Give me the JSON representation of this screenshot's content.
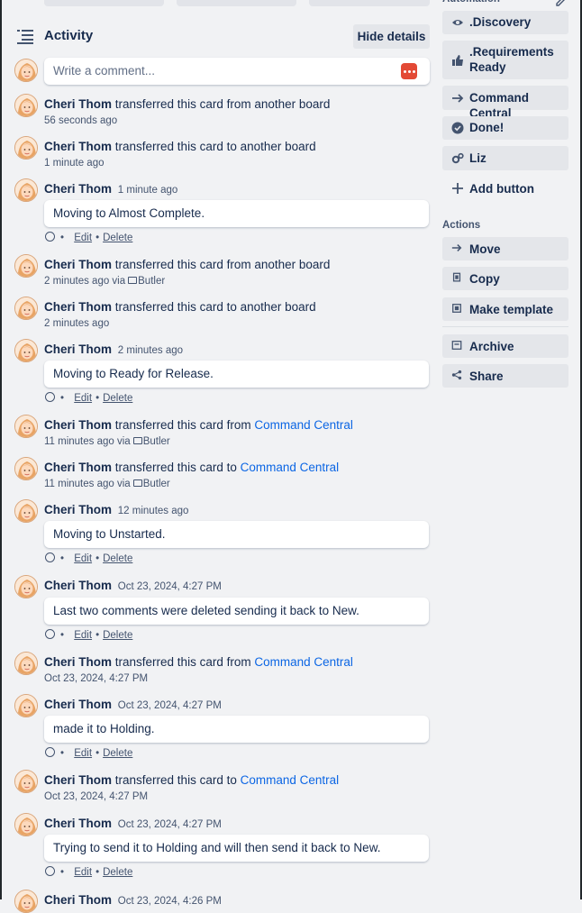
{
  "activity": {
    "title": "Activity",
    "hide_details_label": "Hide details",
    "comment_placeholder": "Write a comment..."
  },
  "entries": [
    {
      "user": "Cheri Thom",
      "action": "transferred this card from another board",
      "time": "56 seconds ago"
    },
    {
      "user": "Cheri Thom",
      "action": "transferred this card to another board",
      "time": "1 minute ago"
    },
    {
      "user": "Cheri Thom",
      "time": "1 minute ago",
      "comment": "Moving to Almost Complete."
    },
    {
      "user": "Cheri Thom",
      "action": "transferred this card from another board",
      "time": "2 minutes ago via",
      "via": "Butler"
    },
    {
      "user": "Cheri Thom",
      "action": "transferred this card to another board",
      "time": "2 minutes ago"
    },
    {
      "user": "Cheri Thom",
      "time": "2 minutes ago",
      "comment": "Moving to Ready for Release."
    },
    {
      "user": "Cheri Thom",
      "action": "transferred this card from",
      "link": "Command Central",
      "time": "11 minutes ago via",
      "via": "Butler"
    },
    {
      "user": "Cheri Thom",
      "action": "transferred this card to",
      "link": "Command Central",
      "time": "11 minutes ago via",
      "via": "Butler"
    },
    {
      "user": "Cheri Thom",
      "time": "12 minutes ago",
      "comment": "Moving to Unstarted."
    },
    {
      "user": "Cheri Thom",
      "time": "Oct 23, 2024, 4:27 PM",
      "comment": "Last two comments were deleted sending it back to New."
    },
    {
      "user": "Cheri Thom",
      "action": "transferred this card from",
      "link": "Command Central",
      "time": "Oct 23, 2024, 4:27 PM"
    },
    {
      "user": "Cheri Thom",
      "time": "Oct 23, 2024, 4:27 PM",
      "comment": "made it to Holding."
    },
    {
      "user": "Cheri Thom",
      "action": "transferred this card to",
      "link": "Command Central",
      "time": "Oct 23, 2024, 4:27 PM"
    },
    {
      "user": "Cheri Thom",
      "time": "Oct 23, 2024, 4:27 PM",
      "comment": "Trying to send it to Holding and will then send it back to New."
    },
    {
      "user": "Cheri Thom",
      "time": "Oct 23, 2024, 4:26 PM"
    }
  ],
  "comment_actions": {
    "edit": "Edit",
    "delete": "Delete",
    "bullet": "•"
  },
  "sidebar": {
    "automation_label": "Automation",
    "automation_buttons": [
      {
        "label": ".Discovery",
        "icon": "eye-icon"
      },
      {
        "label": ".Requirements Ready",
        "icon": "thumbs-up-icon"
      },
      {
        "label": "Command Central",
        "icon": "arrow-right-icon"
      },
      {
        "label": "Done!",
        "icon": "check-circle-icon"
      },
      {
        "label": "Liz",
        "icon": "gears-icon"
      }
    ],
    "add_button_label": "Add button",
    "actions_label": "Actions",
    "actions": [
      {
        "label": "Move",
        "icon": "arrow-right-icon"
      },
      {
        "label": "Copy",
        "icon": "copy-icon"
      },
      {
        "label": "Make template",
        "icon": "template-icon"
      },
      {
        "label": "Archive",
        "icon": "archive-icon"
      },
      {
        "label": "Share",
        "icon": "share-icon"
      }
    ]
  },
  "colors": {
    "link": "#0c66e4",
    "text": "#172b4d",
    "muted": "#44546f",
    "panel": "#f1f2f4",
    "button": "#e4e6ea"
  }
}
